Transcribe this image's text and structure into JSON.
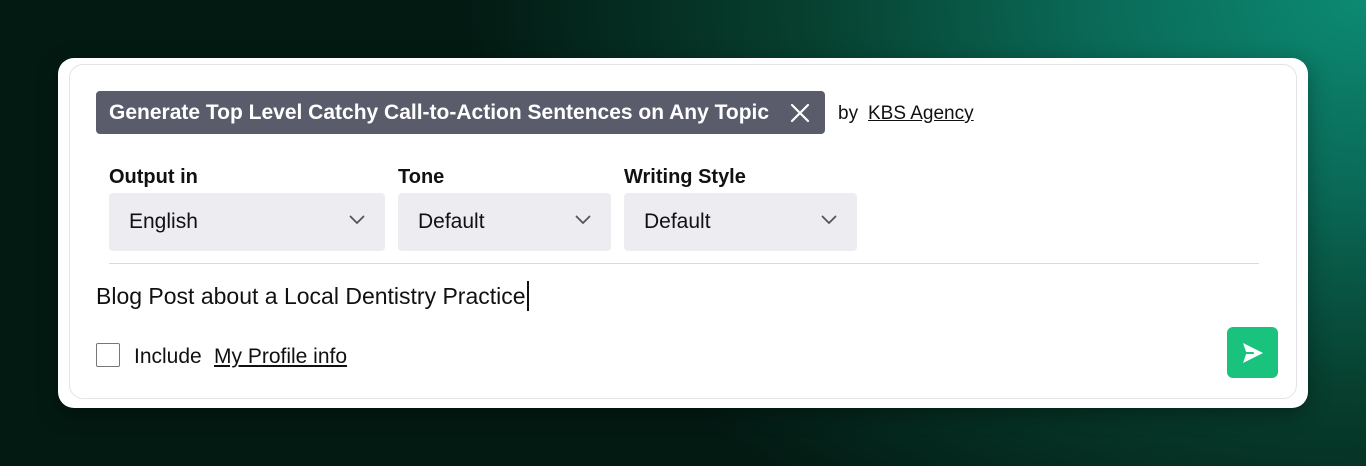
{
  "prompt_card": {
    "title": "Generate Top Level Catchy Call-to-Action Sentences on Any Topic",
    "by_label": "by",
    "author": "KBS Agency"
  },
  "options": [
    {
      "label": "Output in",
      "value": "English"
    },
    {
      "label": "Tone",
      "value": "Default"
    },
    {
      "label": "Writing Style",
      "value": "Default"
    }
  ],
  "input": {
    "value": "Blog Post about a Local Dentistry Practice"
  },
  "profile": {
    "prefix": "Include",
    "link": "My Profile info",
    "checked": false
  },
  "icons": {
    "close": "close-icon",
    "chevron": "chevron-down-icon",
    "send": "send-icon"
  },
  "colors": {
    "accent": "#19c37d",
    "pill": "#5b5c6b",
    "select_bg": "#ececf1"
  }
}
